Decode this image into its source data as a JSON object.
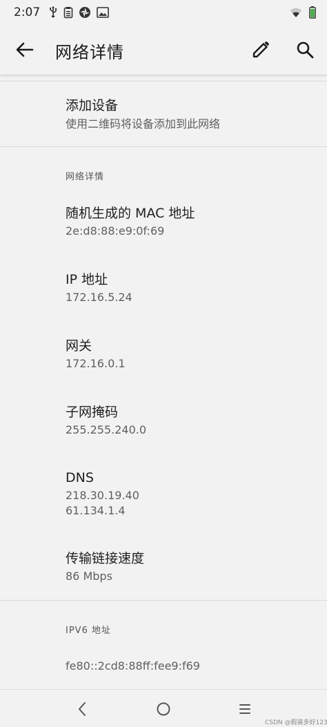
{
  "status_bar": {
    "time": "2:07",
    "left_icons": [
      "usb-icon",
      "clipboard-icon",
      "aperture-icon",
      "image-icon"
    ],
    "right_icons": [
      "wifi-icon",
      "battery-icon"
    ],
    "battery_color": "#4caf50"
  },
  "app_bar": {
    "title": "网络详情",
    "icons": [
      "back-arrow-icon",
      "pencil-icon",
      "search-icon"
    ]
  },
  "add_device": {
    "title": "添加设备",
    "subtitle": "使用二维码将设备添加到此网络"
  },
  "network_details": {
    "header": "网络详情",
    "mac": {
      "label": "随机生成的 MAC 地址",
      "value": "2e:d8:88:e9:0f:69"
    },
    "ip": {
      "label": "IP 地址",
      "value": "172.16.5.24"
    },
    "gateway": {
      "label": "网关",
      "value": "172.16.0.1"
    },
    "subnet": {
      "label": "子网掩码",
      "value": "255.255.240.0"
    },
    "dns": {
      "label": "DNS",
      "values": [
        "218.30.19.40",
        "61.134.1.4"
      ]
    },
    "link_speed": {
      "label": "传输链接速度",
      "value": "86 Mbps"
    }
  },
  "ipv6": {
    "header": "IPV6 地址",
    "value": "fe80::2cd8:88ff:fee9:f69"
  },
  "nav_bar": {
    "icons": [
      "nav-back-icon",
      "nav-home-icon",
      "nav-recents-icon"
    ]
  },
  "watermark": "CSDN @假装多好123",
  "colors": {
    "background": "#f2f2f2",
    "text_primary": "#202020",
    "text_secondary": "#5f5f5f"
  }
}
